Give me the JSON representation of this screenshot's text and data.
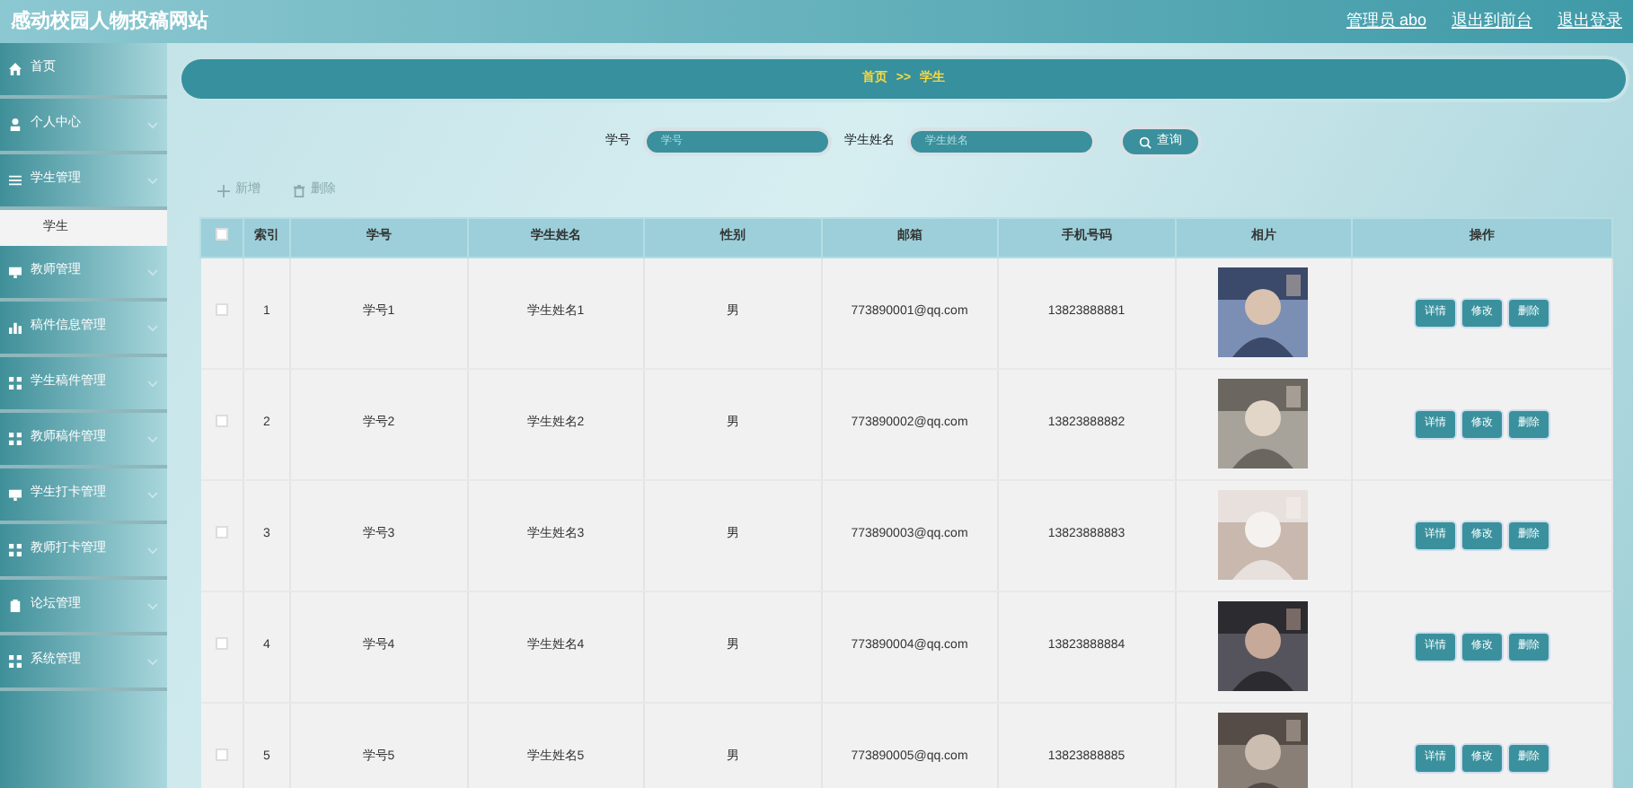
{
  "header": {
    "title": "感动校园人物投稿网站",
    "links": [
      "管理员 abo",
      "退出到前台",
      "退出登录"
    ]
  },
  "sidebar": {
    "items": [
      {
        "label": "首页",
        "kind": "link",
        "selected": false
      },
      {
        "label": "个人中心",
        "kind": "menu",
        "selected": false
      },
      {
        "label": "学生管理",
        "kind": "menu",
        "selected": false,
        "children": [
          {
            "label": "学生",
            "selected": true
          }
        ]
      },
      {
        "label": "教师管理",
        "kind": "menu",
        "selected": false
      },
      {
        "label": "稿件信息管理",
        "kind": "menu",
        "selected": false
      },
      {
        "label": "学生稿件管理",
        "kind": "menu",
        "selected": false
      },
      {
        "label": "教师稿件管理",
        "kind": "menu",
        "selected": false
      },
      {
        "label": "学生打卡管理",
        "kind": "menu",
        "selected": false
      },
      {
        "label": "教师打卡管理",
        "kind": "menu",
        "selected": false
      },
      {
        "label": "论坛管理",
        "kind": "menu",
        "selected": false
      },
      {
        "label": "系统管理",
        "kind": "menu",
        "selected": false
      }
    ]
  },
  "breadcrumb": [
    "首页",
    ">>",
    "学生"
  ],
  "search": {
    "fields": [
      {
        "label": "学号",
        "placeholder": "学号"
      },
      {
        "label": "学生姓名",
        "placeholder": "学生姓名"
      }
    ],
    "button": "查询"
  },
  "toolbar": [
    "新增",
    "删除"
  ],
  "table": {
    "header_checked": false,
    "columns": [
      "索引",
      "学号",
      "学生姓名",
      "性别",
      "邮箱",
      "手机号码",
      "相片",
      "操作"
    ],
    "rows": [
      {
        "checked": false,
        "cells": [
          "1",
          "学号1",
          "学生姓名1",
          "男",
          "773890001@qq.com",
          "13823888881"
        ],
        "actions": [
          "详情",
          "修改",
          "删除"
        ]
      },
      {
        "checked": false,
        "cells": [
          "2",
          "学号2",
          "学生姓名2",
          "男",
          "773890002@qq.com",
          "13823888882"
        ],
        "actions": [
          "详情",
          "修改",
          "删除"
        ]
      },
      {
        "checked": false,
        "cells": [
          "3",
          "学号3",
          "学生姓名3",
          "男",
          "773890003@qq.com",
          "13823888883"
        ],
        "actions": [
          "详情",
          "修改",
          "删除"
        ]
      },
      {
        "checked": false,
        "cells": [
          "4",
          "学号4",
          "学生姓名4",
          "男",
          "773890004@qq.com",
          "13823888884"
        ],
        "actions": [
          "详情",
          "修改",
          "删除"
        ]
      },
      {
        "checked": false,
        "cells": [
          "5",
          "学号5",
          "学生姓名5",
          "男",
          "773890005@qq.com",
          "13823888885"
        ],
        "actions": [
          "详情",
          "修改",
          "删除"
        ]
      }
    ]
  }
}
